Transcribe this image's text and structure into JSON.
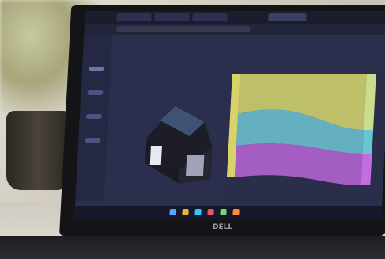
{
  "brand": "DELL"
}
